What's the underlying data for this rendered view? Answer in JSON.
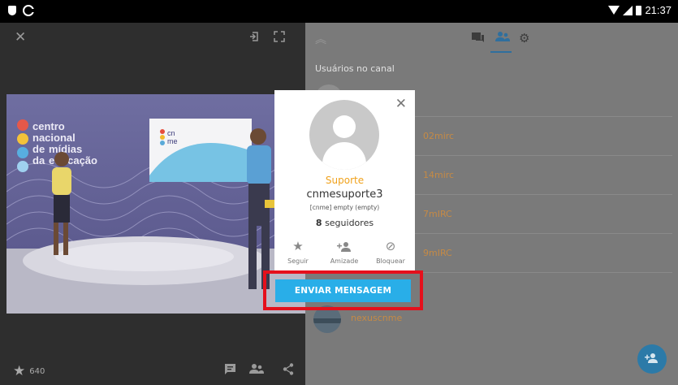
{
  "statusbar": {
    "time": "21:37"
  },
  "video": {
    "star_count": "640",
    "set_logo_lines": [
      "centro",
      "nacional",
      "de",
      "mídias",
      "da",
      "educação"
    ],
    "screen_logo": [
      "cn",
      "me"
    ]
  },
  "channel": {
    "section_title": "Usuários no canal",
    "users": [
      {
        "name": "02mirc"
      },
      {
        "name": "14mirc"
      },
      {
        "name": "7mIRC"
      },
      {
        "name": "9mIRC"
      },
      {
        "name": "nexuscnme"
      }
    ]
  },
  "profile": {
    "role": "Suporte",
    "username": "cnmesuporte3",
    "meta": "[cnme] empty (empty)",
    "followers_count": "8",
    "followers_label": "seguidores",
    "actions": [
      {
        "label": "Seguir",
        "icon": "star-icon"
      },
      {
        "label": "Amizade",
        "icon": "add-friend-icon"
      },
      {
        "label": "Bloquear",
        "icon": "block-icon"
      }
    ],
    "send_button": "ENVIAR MENSAGEM"
  },
  "colors": {
    "accent_orange": "#f0a21c",
    "button_blue": "#29aee8",
    "highlight_red": "#e5101c",
    "fab_blue": "#2c7aa8"
  }
}
